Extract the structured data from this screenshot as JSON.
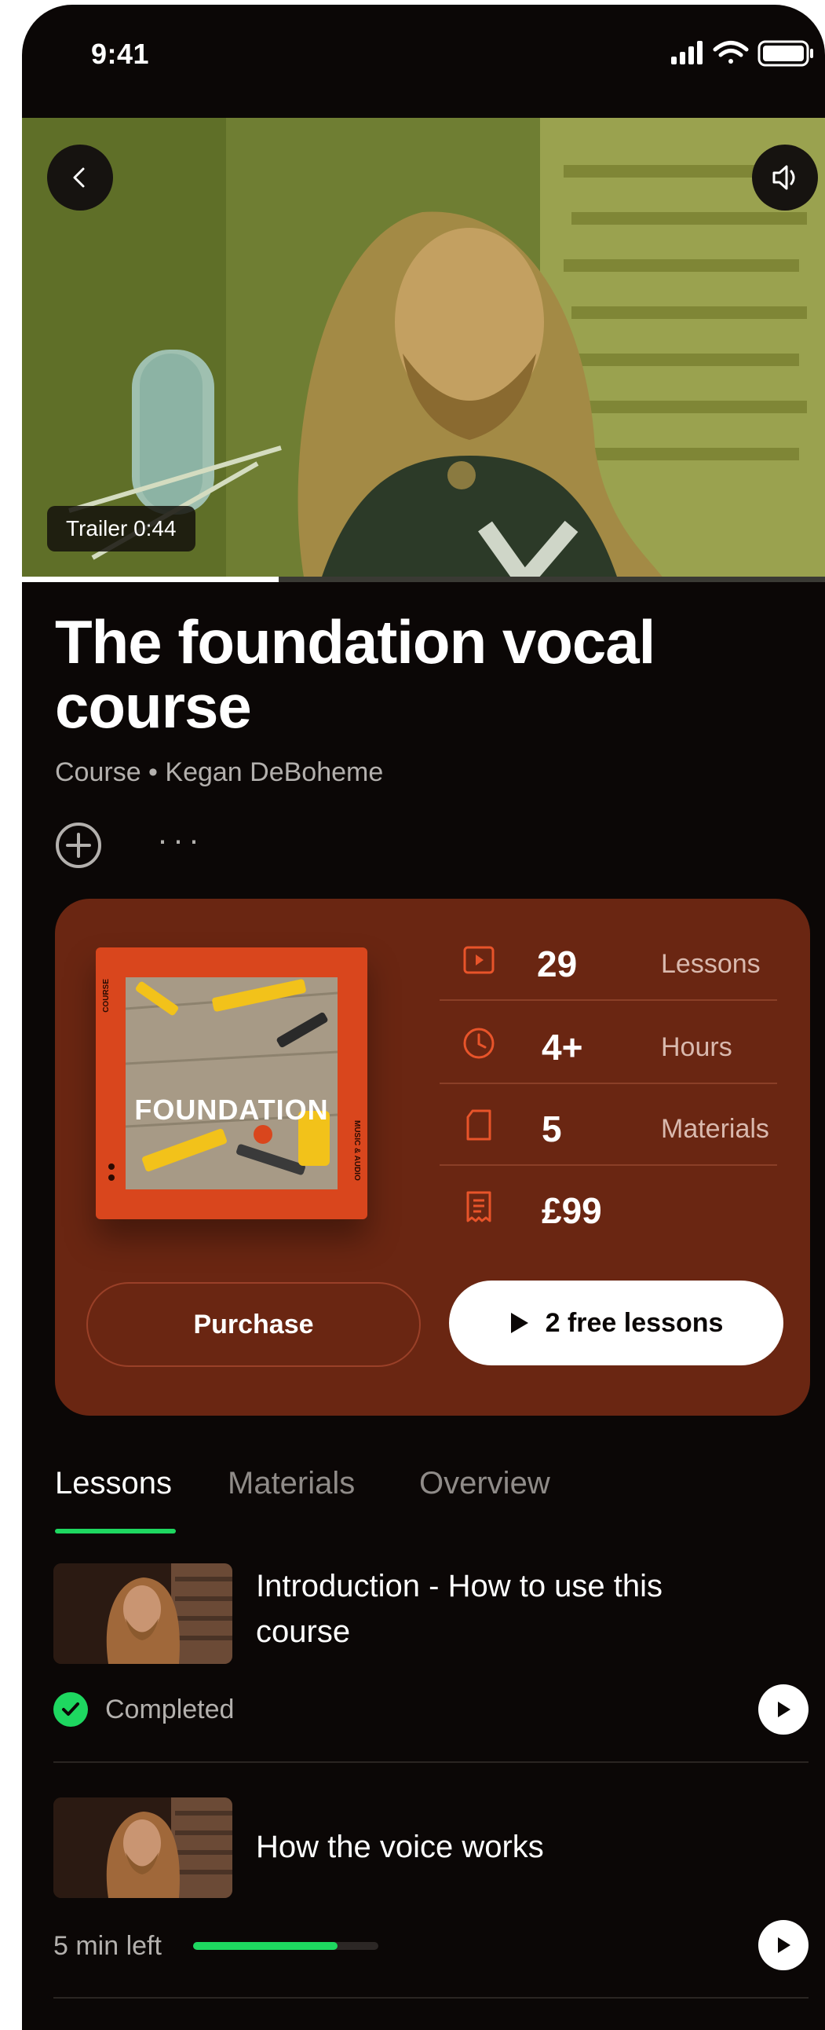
{
  "status_bar": {
    "time": "9:41"
  },
  "video": {
    "trailer_label": "Trailer 0:44",
    "progress": 0.32
  },
  "course": {
    "title": "The foundation vocal course",
    "subtitle": "Course • Kegan DeBoheme",
    "more": "···"
  },
  "card": {
    "cover_word": "FOUNDATION",
    "cover_side_left": "COURSE",
    "cover_side_right": "MUSIC & AUDIO",
    "stats": [
      {
        "icon": "video-icon",
        "value": "29",
        "label": "Lessons"
      },
      {
        "icon": "clock-icon",
        "value": "4+",
        "label": "Hours"
      },
      {
        "icon": "document-icon",
        "value": "5",
        "label": "Materials"
      },
      {
        "icon": "receipt-icon",
        "value": "£99",
        "label": ""
      }
    ],
    "purchase_label": "Purchase",
    "free_label": "2 free lessons",
    "accent": "#6a2612",
    "icon_color": "#e8542a"
  },
  "tabs": [
    {
      "label": "Lessons",
      "active": true
    },
    {
      "label": "Materials",
      "active": false
    },
    {
      "label": "Overview",
      "active": false
    }
  ],
  "lessons": [
    {
      "title": "Introduction - How to use this course",
      "status": "Completed"
    },
    {
      "title": "How the voice works",
      "time_left": "5 min left",
      "progress": 0.78
    }
  ],
  "colors": {
    "green": "#1ed760",
    "background": "#0b0706"
  }
}
